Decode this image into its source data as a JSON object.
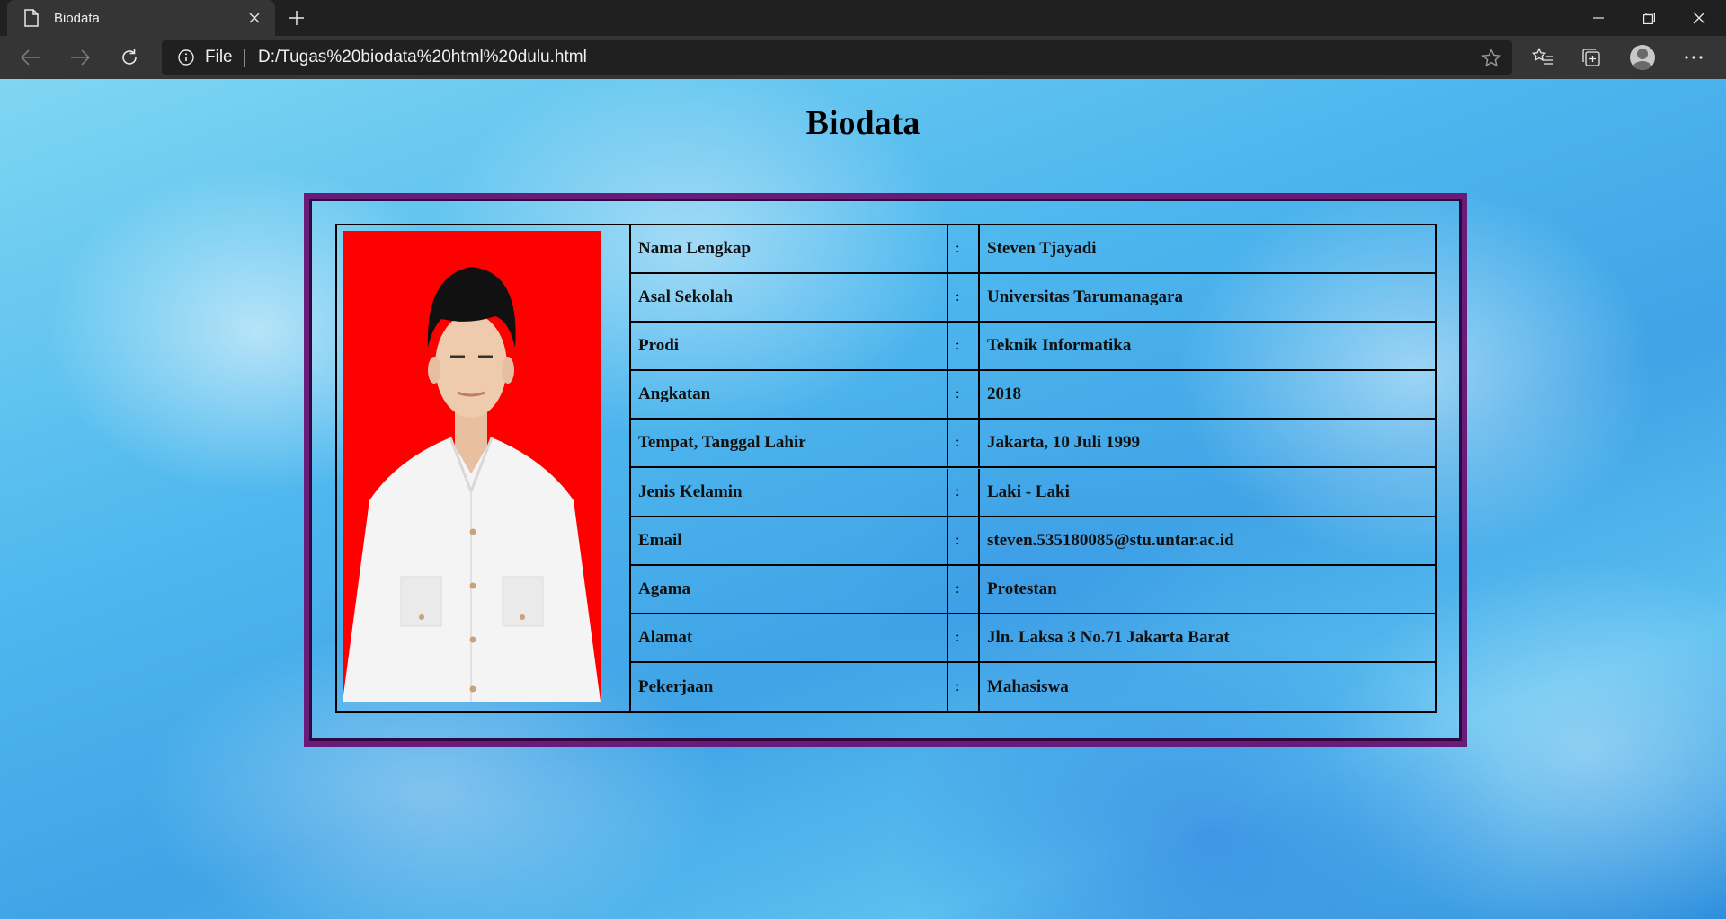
{
  "browser": {
    "tab_title": "Biodata",
    "scheme_label": "File",
    "url": "D:/Tugas%20biodata%20html%20dulu.html"
  },
  "page": {
    "heading": "Biodata"
  },
  "biodata": {
    "rows": [
      {
        "label": "Nama Lengkap",
        "colon": ":",
        "value": "Steven Tjayadi"
      },
      {
        "label": "Asal Sekolah",
        "colon": ":",
        "value": "Universitas Tarumanagara"
      },
      {
        "label": "Prodi",
        "colon": ":",
        "value": "Teknik Informatika"
      },
      {
        "label": "Angkatan",
        "colon": ":",
        "value": "2018"
      },
      {
        "label": "Tempat, Tanggal Lahir",
        "colon": ":",
        "value": "Jakarta, 10 Juli 1999"
      },
      {
        "label": "Jenis Kelamin",
        "colon": ":",
        "value": "Laki - Laki"
      },
      {
        "label": "Email",
        "colon": ":",
        "value": "steven.535180085@stu.untar.ac.id"
      },
      {
        "label": "Agama",
        "colon": ":",
        "value": "Protestan"
      },
      {
        "label": "Alamat",
        "colon": ":",
        "value": "Jln. Laksa 3 No.71 Jakarta Barat"
      },
      {
        "label": "Pekerjaan",
        "colon": ":",
        "value": "Mahasiswa"
      }
    ]
  },
  "colors": {
    "frame_border": "#6a1b7a",
    "photo_background": "#ff0000",
    "chrome_dark": "#202020",
    "chrome_toolbar": "#353535"
  },
  "icons": {
    "tab": "page-icon",
    "close": "close-icon",
    "new_tab": "plus-icon",
    "back": "arrow-left-icon",
    "forward": "arrow-right-icon",
    "refresh": "refresh-icon",
    "site_info": "info-icon",
    "favorite": "star-icon",
    "favorites": "favorites-icon",
    "collections": "collections-icon",
    "profile": "profile-icon",
    "more": "more-icon"
  }
}
